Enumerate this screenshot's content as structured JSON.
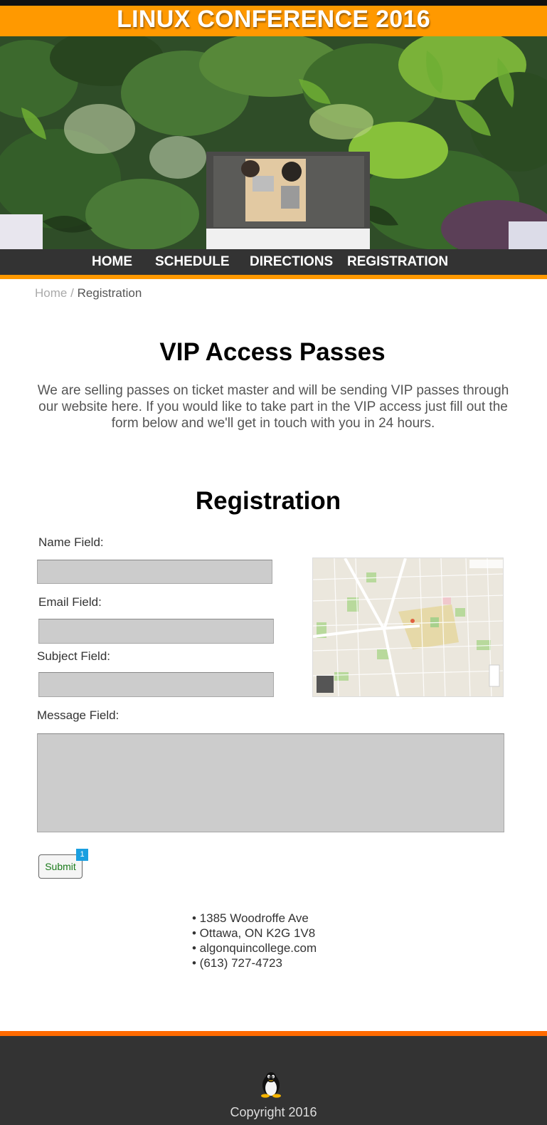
{
  "site": {
    "title": "LINUX CONFERENCE 2016"
  },
  "nav": {
    "items": [
      "HOME",
      "SCHEDULE",
      "DIRECTIONS",
      "REGISTRATION"
    ]
  },
  "breadcrumb": {
    "home": "Home",
    "separator": "/",
    "current": "Registration"
  },
  "vip": {
    "title": "VIP Access Passes",
    "text": "We are selling passes on ticket master and will be sending VIP passes through our website here. If you would like to take part in the VIP access just fill out the form below and we'll get in touch with you in 24 hours."
  },
  "registration": {
    "title": "Registration",
    "name_label": "Name Field:",
    "email_label": "Email Field:",
    "subject_label": "Subject Field:",
    "message_label": "Message Field:",
    "name_value": "",
    "email_value": "",
    "subject_value": "",
    "message_value": "",
    "submit_label": "Submit",
    "submit_badge": "1"
  },
  "address": {
    "lines": [
      "• 1385 Woodroffe Ave",
      "• Ottawa, ON K2G 1V8",
      "• algonquincollege.com",
      "• (613) 727-4723"
    ]
  },
  "footer": {
    "copyright": "Copyright 2016",
    "logo_icon": "tux-penguin-icon"
  },
  "colors": {
    "accent_orange": "#ff9900",
    "footer_orange": "#ff6a00",
    "dark_bar": "#333333",
    "field_gray": "#cccccc",
    "badge_blue": "#1a9fe0"
  }
}
